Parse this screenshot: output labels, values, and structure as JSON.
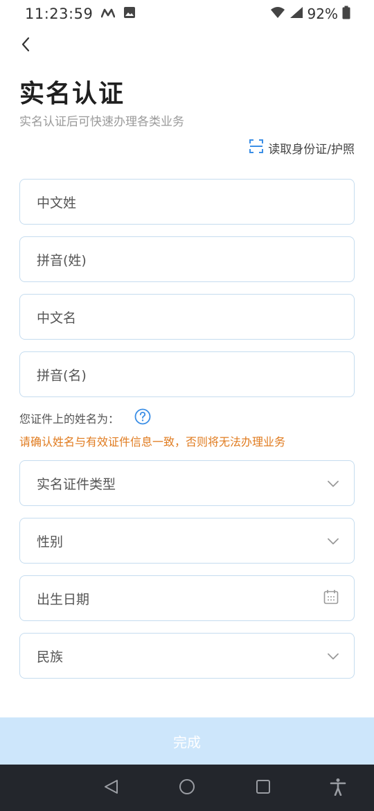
{
  "status_bar": {
    "time": "11:23:59",
    "battery": "92%"
  },
  "header": {
    "title": "实名认证",
    "subtitle": "实名认证后可快速办理各类业务",
    "read_id_label": "读取身份证/护照"
  },
  "form": {
    "surname_cn_placeholder": "中文姓",
    "surname_pinyin_placeholder": "拼音(姓)",
    "given_cn_placeholder": "中文名",
    "given_pinyin_placeholder": "拼音(名)",
    "name_hint_label": "您证件上的姓名为：",
    "warning": "请确认姓名与有效证件信息一致，否则将无法办理业务",
    "id_type_placeholder": "实名证件类型",
    "gender_placeholder": "性别",
    "birthdate_placeholder": "出生日期",
    "ethnicity_placeholder": "民族"
  },
  "footer": {
    "submit_label": "完成"
  },
  "colors": {
    "accent": "#3a8ee6",
    "warning": "#e07b1f",
    "field_border": "#c5dcef",
    "submit_disabled": "#cde6fb",
    "nav_bar": "#23262c"
  }
}
